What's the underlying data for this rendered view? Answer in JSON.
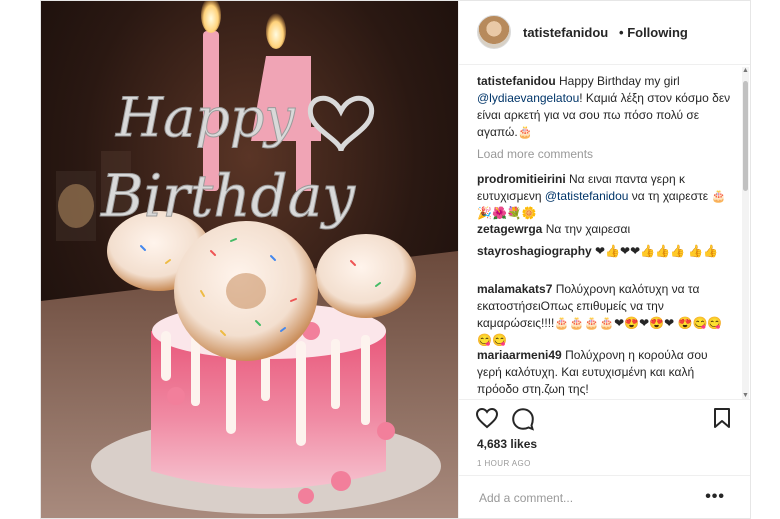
{
  "post": {
    "username": "tatistefanidou",
    "follow_status": "Following",
    "separator": "•",
    "caption_user": "tatistefanidou",
    "caption_text_1": "Happy Birthday my girl",
    "caption_mention": "@lydiaevangelatou",
    "caption_text_2": "! Καμιά λέξη στον κόσμο δεν είναι αρκετή για να σου πω πόσο πολύ σε αγαπώ.🎂",
    "load_more": "Load more comments",
    "comments": [
      {
        "user": "prodromitieirini",
        "pre": "Να ειναι παντα γερη κ ευτυχισμενη",
        "mention": "@tatistefanidou",
        "post": "να τη χαιρεστε 🎂🎉🌺💐🌼"
      },
      {
        "user": "zetagewrga",
        "pre": "Να την χαιρεσαι",
        "mention": "",
        "post": ""
      },
      {
        "user": "stayroshagiography",
        "pre": "❤👍❤❤👍👍👍 👍👍",
        "mention": "",
        "post": ""
      },
      {
        "user": "malamakats7",
        "pre": "Πολύχρονη καλότυχη να τα εκατοστήσειΟπως επιθυμείς να την καμαρώσεις!!!!🎂🎂🎂🎂❤😍❤😍❤ 😍😋😋😋😋",
        "mention": "",
        "post": ""
      },
      {
        "user": "mariaarmeni49",
        "pre": "Πολύχρονη η κορούλα σου γερή καλότυχη. Και ευτυχισμένη και καλή πρόοδο στη.ζωη της!",
        "mention": "",
        "post": ""
      }
    ],
    "likes": "4,683 likes",
    "timestamp": "1 HOUR AGO",
    "add_comment_placeholder": "Add a comment...",
    "more_options": "•••"
  },
  "photo": {
    "topper_line1": "Happy",
    "topper_line2": "Birthday",
    "candle_number": "14"
  },
  "colors": {
    "mention": "#003569",
    "muted": "#999999",
    "border": "#efefef"
  }
}
